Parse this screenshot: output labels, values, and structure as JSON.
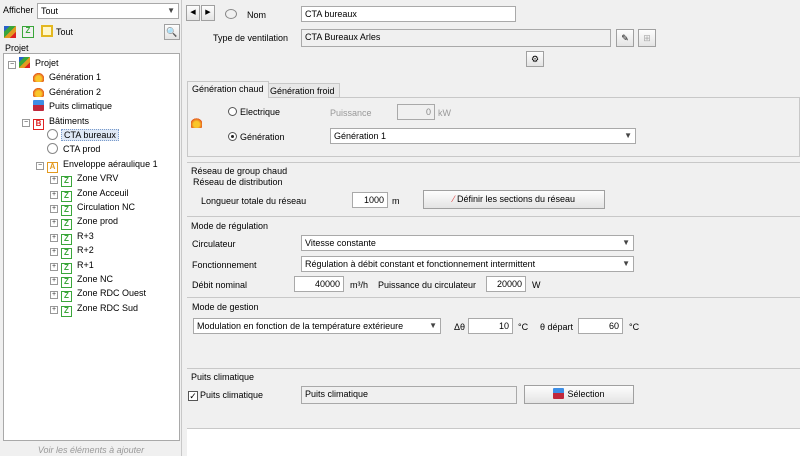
{
  "left": {
    "afficher_label": "Afficher",
    "afficher_value": "Tout",
    "filter_tout": "Tout",
    "tree_header": "Projet",
    "tree": [
      {
        "label": "Projet",
        "indent": 0,
        "icon": "multi",
        "expander": "minus"
      },
      {
        "label": "Génération 1",
        "indent": 1,
        "icon": "flame"
      },
      {
        "label": "Génération 2",
        "indent": 1,
        "icon": "flame"
      },
      {
        "label": "Puits climatique",
        "indent": 1,
        "icon": "puits"
      },
      {
        "label": "Bâtiments",
        "indent": 1,
        "icon": "B",
        "expander": "minus"
      },
      {
        "label": "CTA bureaux",
        "indent": 2,
        "icon": "fan",
        "selected": true
      },
      {
        "label": "CTA prod",
        "indent": 2,
        "icon": "fan"
      },
      {
        "label": "Enveloppe aéraulique 1",
        "indent": 2,
        "icon": "A",
        "expander": "minus"
      },
      {
        "label": "Zone VRV",
        "indent": 3,
        "icon": "Z",
        "expander": "plus"
      },
      {
        "label": "Zone Acceuil",
        "indent": 3,
        "icon": "Z",
        "expander": "plus"
      },
      {
        "label": "Circulation NC",
        "indent": 3,
        "icon": "Z",
        "expander": "plus"
      },
      {
        "label": "Zone prod",
        "indent": 3,
        "icon": "Z",
        "expander": "plus"
      },
      {
        "label": "R+3",
        "indent": 3,
        "icon": "Z",
        "expander": "plus"
      },
      {
        "label": "R+2",
        "indent": 3,
        "icon": "Z",
        "expander": "plus"
      },
      {
        "label": "R+1",
        "indent": 3,
        "icon": "Z",
        "expander": "plus"
      },
      {
        "label": "Zone NC",
        "indent": 3,
        "icon": "Z",
        "expander": "plus"
      },
      {
        "label": "Zone RDC Ouest",
        "indent": 3,
        "icon": "Z",
        "expander": "plus"
      },
      {
        "label": "Zone RDC Sud",
        "indent": 3,
        "icon": "Z",
        "expander": "plus"
      }
    ],
    "footer": "Voir les éléments à ajouter"
  },
  "header": {
    "nom_label": "Nom",
    "nom_value": "CTA bureaux",
    "type_label": "Type de ventilation",
    "type_value": "CTA Bureaux Arles"
  },
  "tabs": [
    "Génération chaud",
    "Génération froid"
  ],
  "generation": {
    "electrique_label": "Electrique",
    "puissance_label": "Puissance",
    "puissance_value": "0",
    "puissance_unit": "kW",
    "generation_label": "Génération",
    "generation_value": "Génération 1"
  },
  "reseau": {
    "title": "Réseau de group chaud",
    "dist_title": "Réseau de distribution",
    "longueur_label": "Longueur totale du réseau",
    "longueur_value": "1000",
    "longueur_unit": "m",
    "definir_button": "Définir les sections du réseau"
  },
  "regulation": {
    "title": "Mode de régulation",
    "circulateur_label": "Circulateur",
    "circulateur_value": "Vitesse constante",
    "fonctionnement_label": "Fonctionnement",
    "fonctionnement_value": "Régulation à débit constant et fonctionnement intermittent",
    "debit_label": "Débit nominal",
    "debit_value": "40000",
    "debit_unit": "m³/h",
    "puissance_circ_label": "Puissance du circulateur",
    "puissance_circ_value": "20000",
    "puissance_circ_unit": "W"
  },
  "gestion": {
    "title": "Mode de gestion",
    "mode_value": "Modulation en fonction de la température extérieure",
    "delta_label": "Δθ",
    "delta_value": "10",
    "delta_unit": "°C",
    "depart_label": "θ départ",
    "depart_value": "60",
    "depart_unit": "°C"
  },
  "puits": {
    "title": "Puits climatique",
    "checkbox_label": "Puits climatique",
    "value": "Puits climatique",
    "selection_button": "Sélection"
  }
}
